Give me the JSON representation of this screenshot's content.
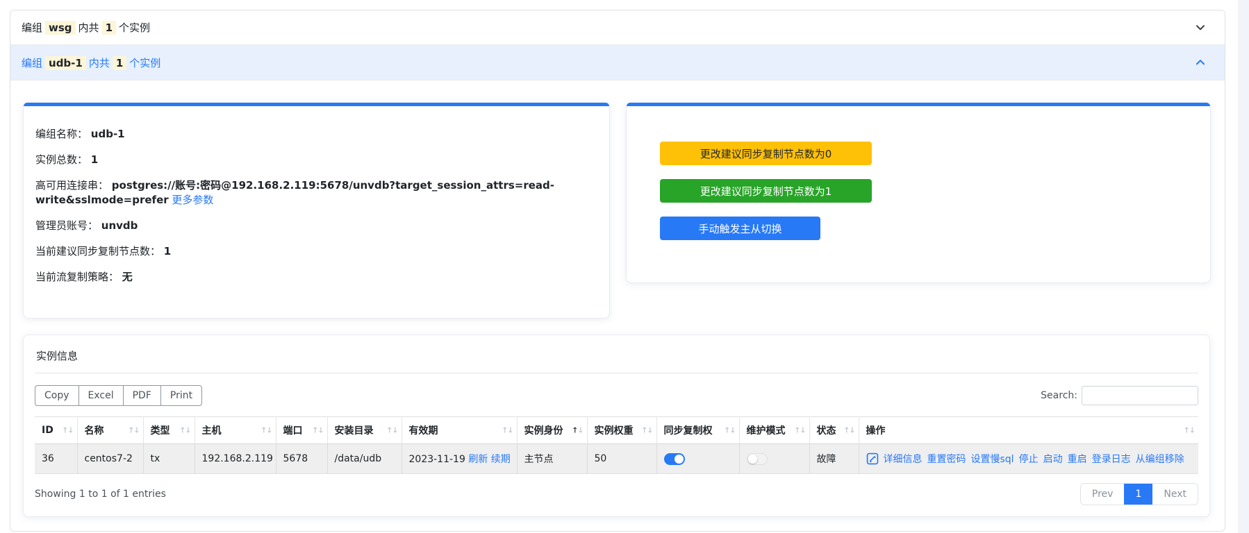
{
  "accordion": [
    {
      "prefix": "编组",
      "name": "wsg",
      "middle": "内共",
      "count": "1",
      "suffix": "个实例",
      "expanded": false
    },
    {
      "prefix": "编组",
      "name": "udb-1",
      "middle": "内共",
      "count": "1",
      "suffix": "个实例",
      "expanded": true
    }
  ],
  "group_detail": {
    "fields": [
      {
        "label": "编组名称：",
        "value": "udb-1"
      },
      {
        "label": "实例总数：",
        "value": "1"
      },
      {
        "label": "高可用连接串：",
        "value": "postgres://账号:密码@192.168.2.119:5678/unvdb?target_session_attrs=read-write&sslmode=prefer",
        "link": "更多参数"
      },
      {
        "label": "管理员账号：",
        "value": "unvdb"
      },
      {
        "label": "当前建议同步复制节点数：",
        "value": "1"
      },
      {
        "label": "当前流复制策略：",
        "value": "无"
      }
    ]
  },
  "actions_panel": {
    "buttons": [
      {
        "label": "更改建议同步复制节点数为0",
        "color": "#ffc107"
      },
      {
        "label": "更改建议同步复制节点数为1",
        "color": "#28a428"
      },
      {
        "label": "手动触发主从切换",
        "color": "#2779f6"
      }
    ]
  },
  "instances": {
    "title": "实例信息",
    "export_buttons": [
      "Copy",
      "Excel",
      "PDF",
      "Print"
    ],
    "search_label": "Search:",
    "search_value": "",
    "columns": [
      {
        "label": "ID",
        "sorted": ""
      },
      {
        "label": "名称",
        "sorted": ""
      },
      {
        "label": "类型",
        "sorted": ""
      },
      {
        "label": "主机",
        "sorted": ""
      },
      {
        "label": "端口",
        "sorted": ""
      },
      {
        "label": "安装目录",
        "sorted": ""
      },
      {
        "label": "有效期",
        "sorted": ""
      },
      {
        "label": "实例身份",
        "sorted": "asc"
      },
      {
        "label": "实例权重",
        "sorted": ""
      },
      {
        "label": "同步复制权",
        "sorted": ""
      },
      {
        "label": "维护模式",
        "sorted": ""
      },
      {
        "label": "状态",
        "sorted": ""
      },
      {
        "label": "操作",
        "sorted": ""
      }
    ],
    "row": {
      "id": "36",
      "name": "centos7-2",
      "type": "tx",
      "host": "192.168.2.119",
      "port": "5678",
      "install_dir": "/data/udb",
      "expiry_date": "2023-11-19",
      "expiry_links": {
        "refresh": "刷新",
        "renew": "续期"
      },
      "role": "主节点",
      "weight": "50",
      "sync_replication_on": true,
      "maintenance_mode_on": false,
      "status": "故障",
      "action_icon": "edit-icon",
      "actions": [
        "详细信息",
        "重置密码",
        "设置慢sql",
        "停止",
        "启动",
        "重启",
        "登录日志",
        "从编组移除"
      ]
    },
    "footer": {
      "showing": "Showing 1 to 1 of 1 entries",
      "prev": "Prev",
      "page": "1",
      "next": "Next"
    }
  },
  "colors": {
    "primary": "#2779f6",
    "warning": "#ffc107",
    "success": "#28a428",
    "expanded_bg": "#e7f0fc",
    "mark_bg": "#fcf5d8",
    "row_bg": "#efefef"
  }
}
